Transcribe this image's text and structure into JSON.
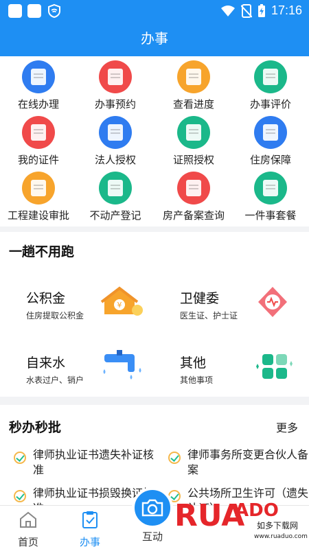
{
  "status_bar": {
    "time": "17:16"
  },
  "header": {
    "title": "办事"
  },
  "grid": {
    "items": [
      {
        "label": "在线办理",
        "icon": "monitor-icon",
        "color": "#2f7cf0"
      },
      {
        "label": "办事预约",
        "icon": "calendar-list-icon",
        "color": "#f04a4a"
      },
      {
        "label": "查看进度",
        "icon": "progress-doc-icon",
        "color": "#f7a42c"
      },
      {
        "label": "办事评价",
        "icon": "comment-icon",
        "color": "#1bb88a"
      },
      {
        "label": "我的证件",
        "icon": "certificate-icon",
        "color": "#f04a4a"
      },
      {
        "label": "法人授权",
        "icon": "id-card-icon",
        "color": "#2f7cf0"
      },
      {
        "label": "证照授权",
        "icon": "license-icon",
        "color": "#1bb88a"
      },
      {
        "label": "住房保障",
        "icon": "building-icon",
        "color": "#2f7cf0"
      },
      {
        "label": "工程建设审批",
        "icon": "construction-doc-icon",
        "color": "#f7a42c"
      },
      {
        "label": "不动产登记",
        "icon": "property-doc-icon",
        "color": "#1bb88a"
      },
      {
        "label": "房产备案查询",
        "icon": "house-search-icon",
        "color": "#f04a4a"
      },
      {
        "label": "一件事套餐",
        "icon": "user-doc-icon",
        "color": "#1bb88a"
      }
    ]
  },
  "section_run_once": {
    "title": "一趟不用跑",
    "services": [
      {
        "title": "公积金",
        "subtitle": "住房提取公积金",
        "icon": "house-coin-icon"
      },
      {
        "title": "卫健委",
        "subtitle": "医生证、护士证",
        "icon": "health-emblem-icon"
      },
      {
        "title": "自来水",
        "subtitle": "水表过户、销户",
        "icon": "water-tap-icon"
      },
      {
        "title": "其他",
        "subtitle": "其他事项",
        "icon": "grid-squares-icon"
      }
    ]
  },
  "section_quick": {
    "title": "秒办秒批",
    "more": "更多",
    "items": [
      {
        "text": "律师执业证书遗失补证核准"
      },
      {
        "text": "律师事务所变更合伙人备案"
      },
      {
        "text": "律师执业证书损毁换证核准"
      },
      {
        "text": "公共场所卫生许可（遗失补证）"
      }
    ]
  },
  "tabbar": {
    "tabs": [
      {
        "label": "首页",
        "icon": "home-icon",
        "active": false
      },
      {
        "label": "办事",
        "icon": "clipboard-check-icon",
        "active": true
      },
      {
        "label": "互动",
        "icon": "camera-icon",
        "active": false
      }
    ]
  },
  "watermark": {
    "brand": "RUANDAO",
    "name": "如多下载网",
    "url": "www.ruaduo.com"
  },
  "colors": {
    "primary": "#1e8ff3",
    "accent_orange": "#f7a42c",
    "accent_red": "#f04a4a",
    "accent_green": "#1bb88a"
  }
}
